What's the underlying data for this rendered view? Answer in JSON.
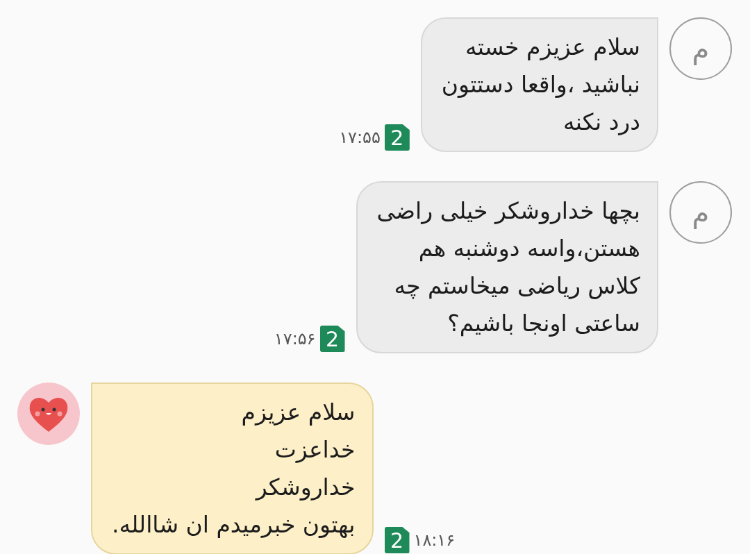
{
  "messages": [
    {
      "kind": "incoming",
      "avatar": "م",
      "text": "سلام عزیزم خسته\nنباشید ،واقعا دستتون\nدرد نکنه",
      "sim": "2",
      "time": "۱۷:۵۵"
    },
    {
      "kind": "incoming",
      "avatar": "م",
      "text": "بچها خداروشکر خیلی راضی\nهستن،واسه دوشنبه هم\nکلاس ریاضی میخاستم چه\nساعتی اونجا باشیم؟",
      "sim": "2",
      "time": "۱۷:۵۶"
    },
    {
      "kind": "outgoing",
      "text": "سلام عزیزم\nخداعزت\nخداروشکر\nبهتون خبرمیدم ان شاالله.",
      "sim": "2",
      "time": "۱۸:۱۶"
    }
  ]
}
